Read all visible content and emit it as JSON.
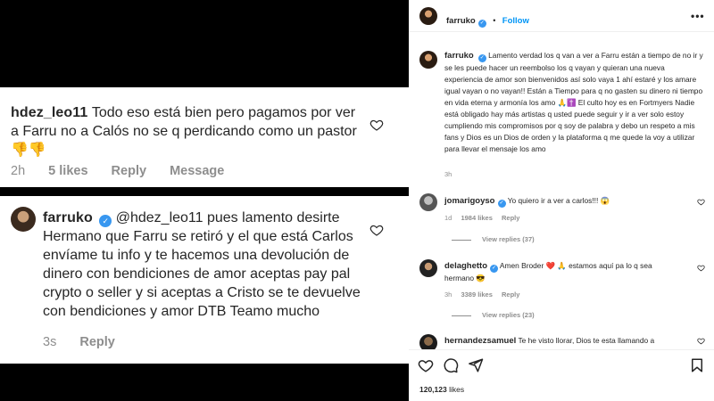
{
  "post_image": {
    "comment_1": {
      "username": "hdez_leo11",
      "text": "Todo eso está bien pero pagamos por ver a Farru no a Calós no se q perdicando como un pastor👎👎",
      "time": "2h",
      "likes": "5 likes",
      "reply": "Reply",
      "message": "Message"
    },
    "comment_2": {
      "username": "farruko",
      "text": "@hdez_leo11 pues lamento desirte Hermano que Farru se retiró y el que está Carlos envíame tu info y te hacemos una devolución de dinero con bendiciones de amor aceptas pay pal crypto o seller y si aceptas a Cristo se te devuelve con bendiciones y amor DTB Teamo mucho",
      "time": "3s",
      "reply": "Reply"
    }
  },
  "header": {
    "username": "farruko",
    "separator": "•",
    "follow": "Follow",
    "more": "•••"
  },
  "caption": {
    "username": "farruko",
    "text": "Lamento verdad los q van a ver a Farru están a tiempo de no ir y se les puede hacer un reembolso los q vayan y quieran una nueva experiencia de amor son bienvenidos así solo vaya 1 ahí estaré y los amare igual vayan o no vayan!! Están a Tiempo para q no gasten su dinero ni tiempo en vida eterna y armonía los amo 🙏✝️ El culto hoy es en Fortmyers Nadie está obligado hay más artistas q usted puede seguir y ir a ver solo estoy cumpliendo mis compromisos por q soy de palabra y debo un respeto a mis fans y Dios es un Dios de orden y la plataforma q me quede la voy a utilizar para llevar el mensaje los amo",
    "time": "3h"
  },
  "comments": [
    {
      "username": "jomarigoyso",
      "text": "Yo quiero ir a ver a carlos!!! 😱",
      "time": "1d",
      "likes": "1984 likes",
      "reply": "Reply",
      "view_replies": "View replies (37)"
    },
    {
      "username": "delaghetto",
      "text": "Amen Broder ❤️ 🙏 estamos aquí pa lo q sea hermano 😎",
      "time": "3h",
      "likes": "3389 likes",
      "reply": "Reply",
      "view_replies": "View replies (23)"
    },
    {
      "username": "hernandezsamuel",
      "text": "Te he visto llorar, Dios te esta llamando a"
    }
  ],
  "footer": {
    "likes_count": "120,123",
    "likes_word": "likes"
  },
  "colors": {
    "accent": "#0095f6",
    "verified": "#3897f0",
    "heart_red": "#ed4956"
  }
}
